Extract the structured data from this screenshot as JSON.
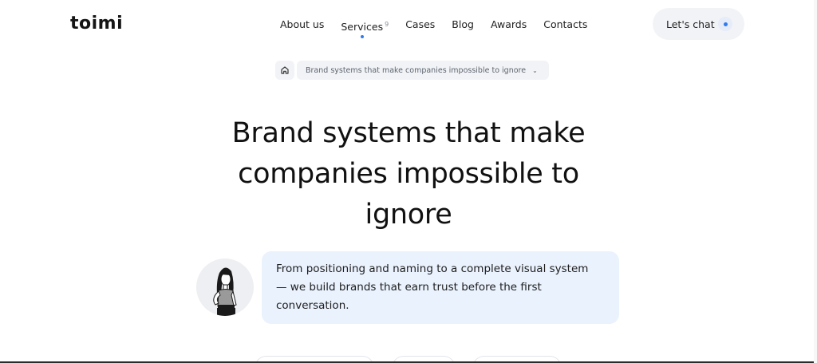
{
  "header": {
    "logo": "toimi",
    "nav": [
      {
        "label": "About us"
      },
      {
        "label": "Services",
        "count": "9",
        "active": true
      },
      {
        "label": "Cases"
      },
      {
        "label": "Blog"
      },
      {
        "label": "Awards"
      },
      {
        "label": "Contacts"
      }
    ],
    "cta_label": "Let's chat"
  },
  "breadcrumb": {
    "home_icon": "home-icon",
    "current": "Brand systems that make companies impossible to ignore"
  },
  "hero": {
    "title_line1": "Brand systems that make",
    "title_line2": "companies impossible to",
    "title_line3": "ignore",
    "quote_line1": "From positioning and naming to a complete visual system",
    "quote_line2": "— we build brands that earn trust before the first",
    "quote_line3": "conversation."
  },
  "colors": {
    "accent": "#2f7bf0",
    "chip_bg": "#f2f3f6",
    "bubble_bg": "#eaf2fd"
  }
}
